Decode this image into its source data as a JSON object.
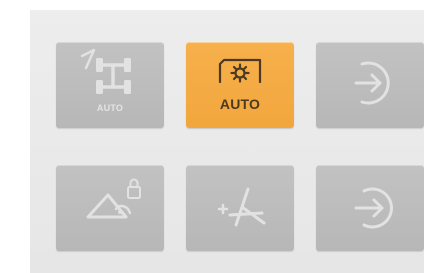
{
  "panel": {
    "colors": {
      "background": "#e9e9e9",
      "button": "#bdbdbd",
      "button_active": "#f4a940",
      "glyph_light": "#e2e2e2",
      "glyph_dark": "#4a3a22"
    },
    "buttons": [
      {
        "id": "axle-auto",
        "icon": "axle-steering-icon",
        "label": "AUTO",
        "active": false
      },
      {
        "id": "auto-mode",
        "icon": "gear-in-frame-icon",
        "label": "AUTO",
        "active": true
      },
      {
        "id": "enter-right",
        "icon": "arrow-in-circle-right-icon",
        "label": "",
        "active": false
      },
      {
        "id": "hitch-lock",
        "icon": "implement-lock-icon",
        "label": "",
        "active": false
      },
      {
        "id": "implement-plus",
        "icon": "implement-plus-icon",
        "label": "",
        "active": false
      },
      {
        "id": "enter-left",
        "icon": "arrow-in-circle-left-icon",
        "label": "",
        "active": false
      }
    ]
  }
}
